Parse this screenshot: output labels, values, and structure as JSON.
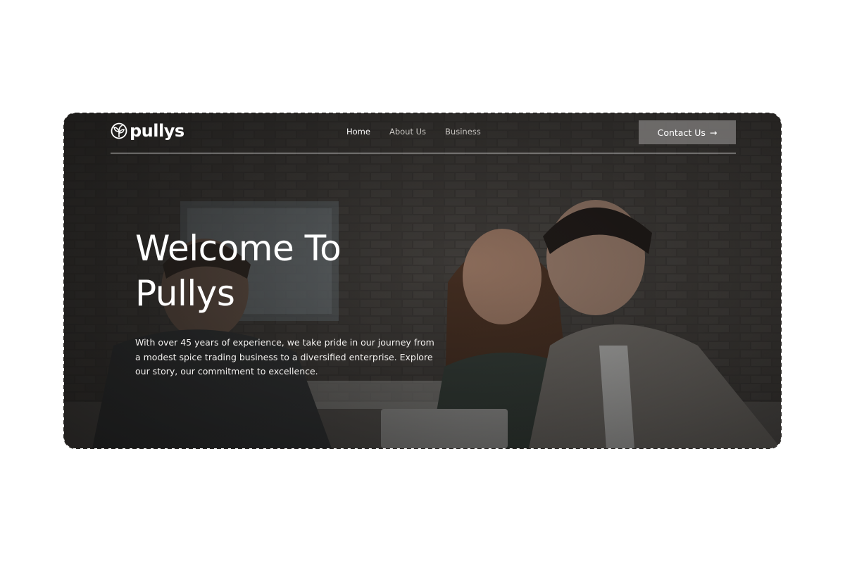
{
  "brand": {
    "name": "pullys",
    "logo_icon": "leaf-logo-icon"
  },
  "nav": {
    "items": [
      {
        "label": "Home",
        "active": true
      },
      {
        "label": "About Us",
        "active": false
      },
      {
        "label": "Business",
        "active": false
      }
    ]
  },
  "contact": {
    "label": "Contact Us",
    "arrow": "→"
  },
  "hero": {
    "title_line1": "Welcome To",
    "title_line2": "Pullys",
    "description": "With over 45 years of experience, we take pride in our journey from a modest spice trading business to a diversified enterprise. Explore our story, our commitment to excellence.",
    "background_image": "office-meeting-photo"
  },
  "colors": {
    "page_background": "#ffffff",
    "hero_overlay": "#141312",
    "button_background": "#787674",
    "text_primary": "#ffffff",
    "nav_inactive": "#c9c6c2"
  }
}
